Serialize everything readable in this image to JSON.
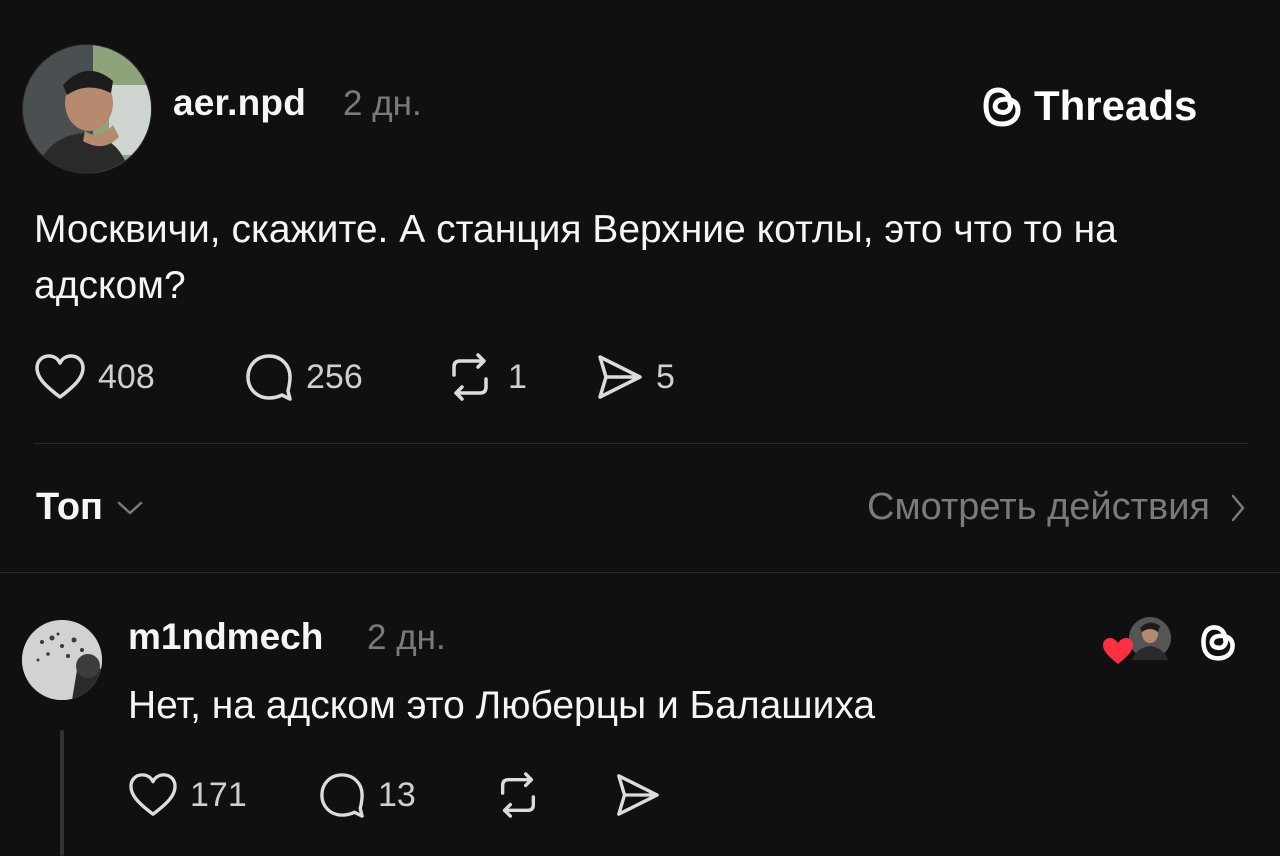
{
  "post": {
    "username": "aer.npd",
    "time": "2 дн.",
    "text": "Москвичи, скажите. А станция Верхние котлы, это что то на адском?",
    "likes": "408",
    "comments": "256",
    "reposts": "1",
    "shares": "5",
    "avatar_icon": "profile-photo"
  },
  "brand": {
    "name": "Threads",
    "icon": "threads-logo-icon"
  },
  "filter": {
    "sort_label": "Топ",
    "view_activity_label": "Смотреть действия"
  },
  "reply": {
    "username": "m1ndmech",
    "time": "2 дн.",
    "text": "Нет, на адском это Люберцы и Балашиха",
    "likes": "171",
    "comments": "13",
    "liked_by_author_icon": "red-heart-icon"
  },
  "colors": {
    "background": "#101010",
    "text": "#f3f5f7",
    "muted": "#7a7a7a",
    "divider": "#2c2c2c",
    "heart": "#ff3040"
  }
}
